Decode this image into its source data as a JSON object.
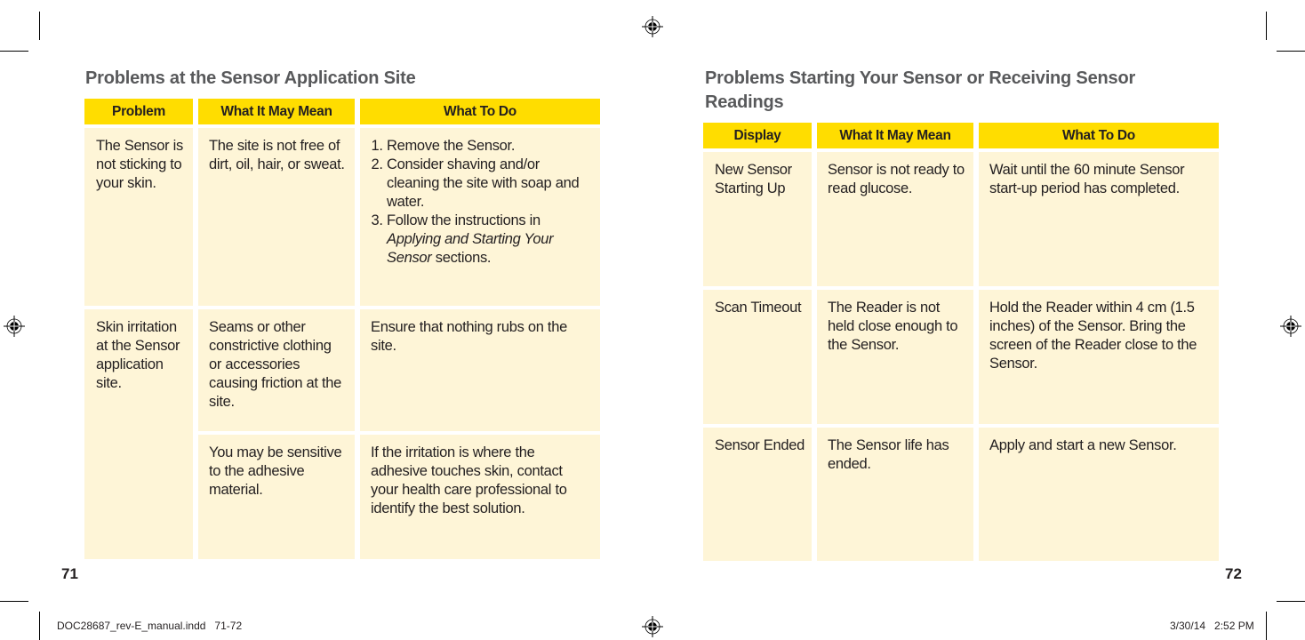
{
  "left_page": {
    "title": "Problems at the Sensor Application  Site",
    "headers": [
      "Problem",
      "What It May Mean",
      "What To Do"
    ],
    "rows": [
      {
        "problem": "The Sensor is not sticking to your skin.",
        "meaning": "The site is not free of dirt, oil, hair, or sweat.",
        "todo_steps": [
          "Remove the Sensor.",
          "Consider shaving and/or cleaning the site with soap and water."
        ],
        "todo_step3_prefix": " Follow the instructions in ",
        "todo_step3_italic": "Applying and Starting Your Sensor",
        "todo_step3_suffix": " sections."
      },
      {
        "problem": "Skin irritation at the Sensor application site.",
        "meaning": "Seams or other constrictive clothing or accessories causing friction at the site.",
        "todo": "Ensure that nothing rubs on the site."
      },
      {
        "meaning": "You may be sensitive to the adhesive material.",
        "todo": "If the irritation is where the adhesive touches skin, contact your health care professional to identify the best solution."
      }
    ],
    "page_number": "71"
  },
  "right_page": {
    "title": "Problems Starting  Your Sensor or Receiving Sensor Readings",
    "headers": [
      "Display",
      "What It May Mean",
      "What To Do"
    ],
    "rows": [
      {
        "display": "New Sensor Starting Up",
        "meaning": "Sensor is not ready to read glucose.",
        "todo": "Wait until the 60 minute Sensor start-up period has completed."
      },
      {
        "display": "Scan Timeout",
        "meaning": "The Reader is not held close enough to the Sensor.",
        "todo": "Hold the Reader within 4 cm (1.5 inches) of the Sensor. Bring the screen of the Reader close to the Sensor."
      },
      {
        "display": "Sensor Ended",
        "meaning": "The Sensor life has ended.",
        "todo": "Apply and start a new Sensor."
      }
    ],
    "page_number": "72"
  },
  "slug": {
    "file": "DOC28687_rev-E_manual.indd   71-72",
    "datetime": "3/30/14   2:52 PM"
  },
  "colors": {
    "header_yellow": "#ffdd00",
    "cell_cream": "#fef5d7",
    "title_gray": "#58595b"
  }
}
